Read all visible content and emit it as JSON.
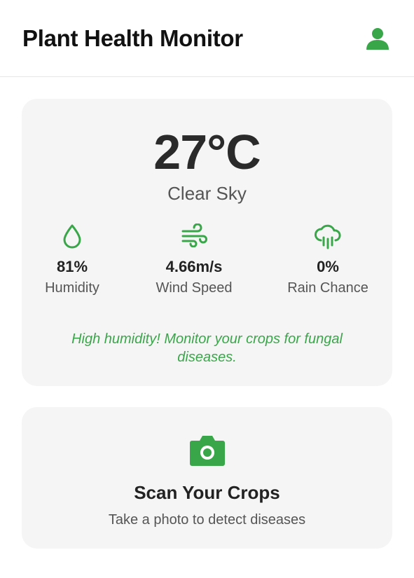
{
  "header": {
    "title": "Plant Health Monitor",
    "profile_icon": "user-icon"
  },
  "weather": {
    "temperature": "27°C",
    "condition": "Clear Sky",
    "stats": [
      {
        "icon": "droplet-icon",
        "value": "81%",
        "label": "Humidity"
      },
      {
        "icon": "wind-icon",
        "value": "4.66m/s",
        "label": "Wind Speed"
      },
      {
        "icon": "rain-cloud-icon",
        "value": "0%",
        "label": "Rain Chance"
      }
    ],
    "alert": "High humidity! Monitor your crops for fungal diseases."
  },
  "scan": {
    "icon": "camera-icon",
    "title": "Scan Your Crops",
    "subtitle": "Take a photo to detect diseases"
  },
  "colors": {
    "accent": "#3aa64a",
    "card_bg": "#f5f5f5"
  }
}
